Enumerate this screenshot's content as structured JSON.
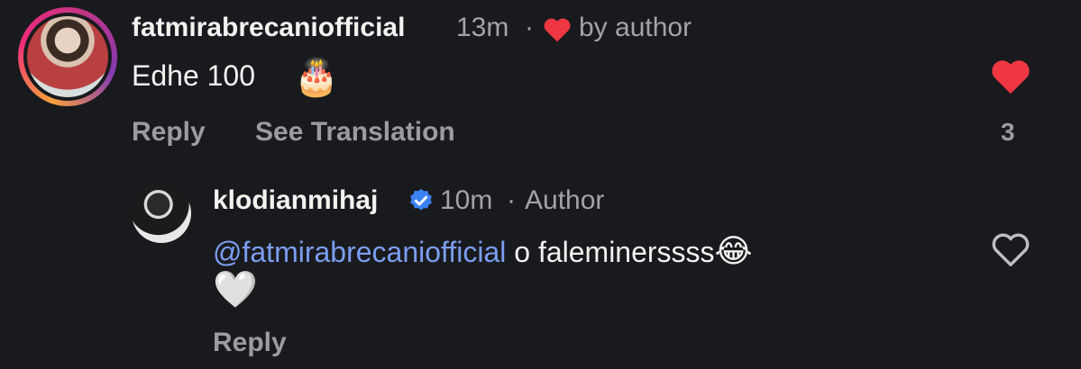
{
  "comment": {
    "username": "fatmirabrecaniofficial",
    "time": "13m",
    "dot": "·",
    "liked_by": "by author",
    "text": "Edhe 100",
    "emoji": "🎂",
    "reply_label": "Reply",
    "translate_label": "See Translation",
    "like_count": "3",
    "colors": {
      "like": "#ee3742",
      "mention": "#7b9ef0"
    }
  },
  "reply": {
    "username": "klodianmihaj",
    "time": "10m",
    "dot": "·",
    "tag": "Author",
    "mention": "@fatmirabrecaniofficial",
    "text": " o faleminerssss",
    "emoji_laugh": "😂",
    "emoji_heart": "🤍",
    "reply_label": "Reply"
  }
}
